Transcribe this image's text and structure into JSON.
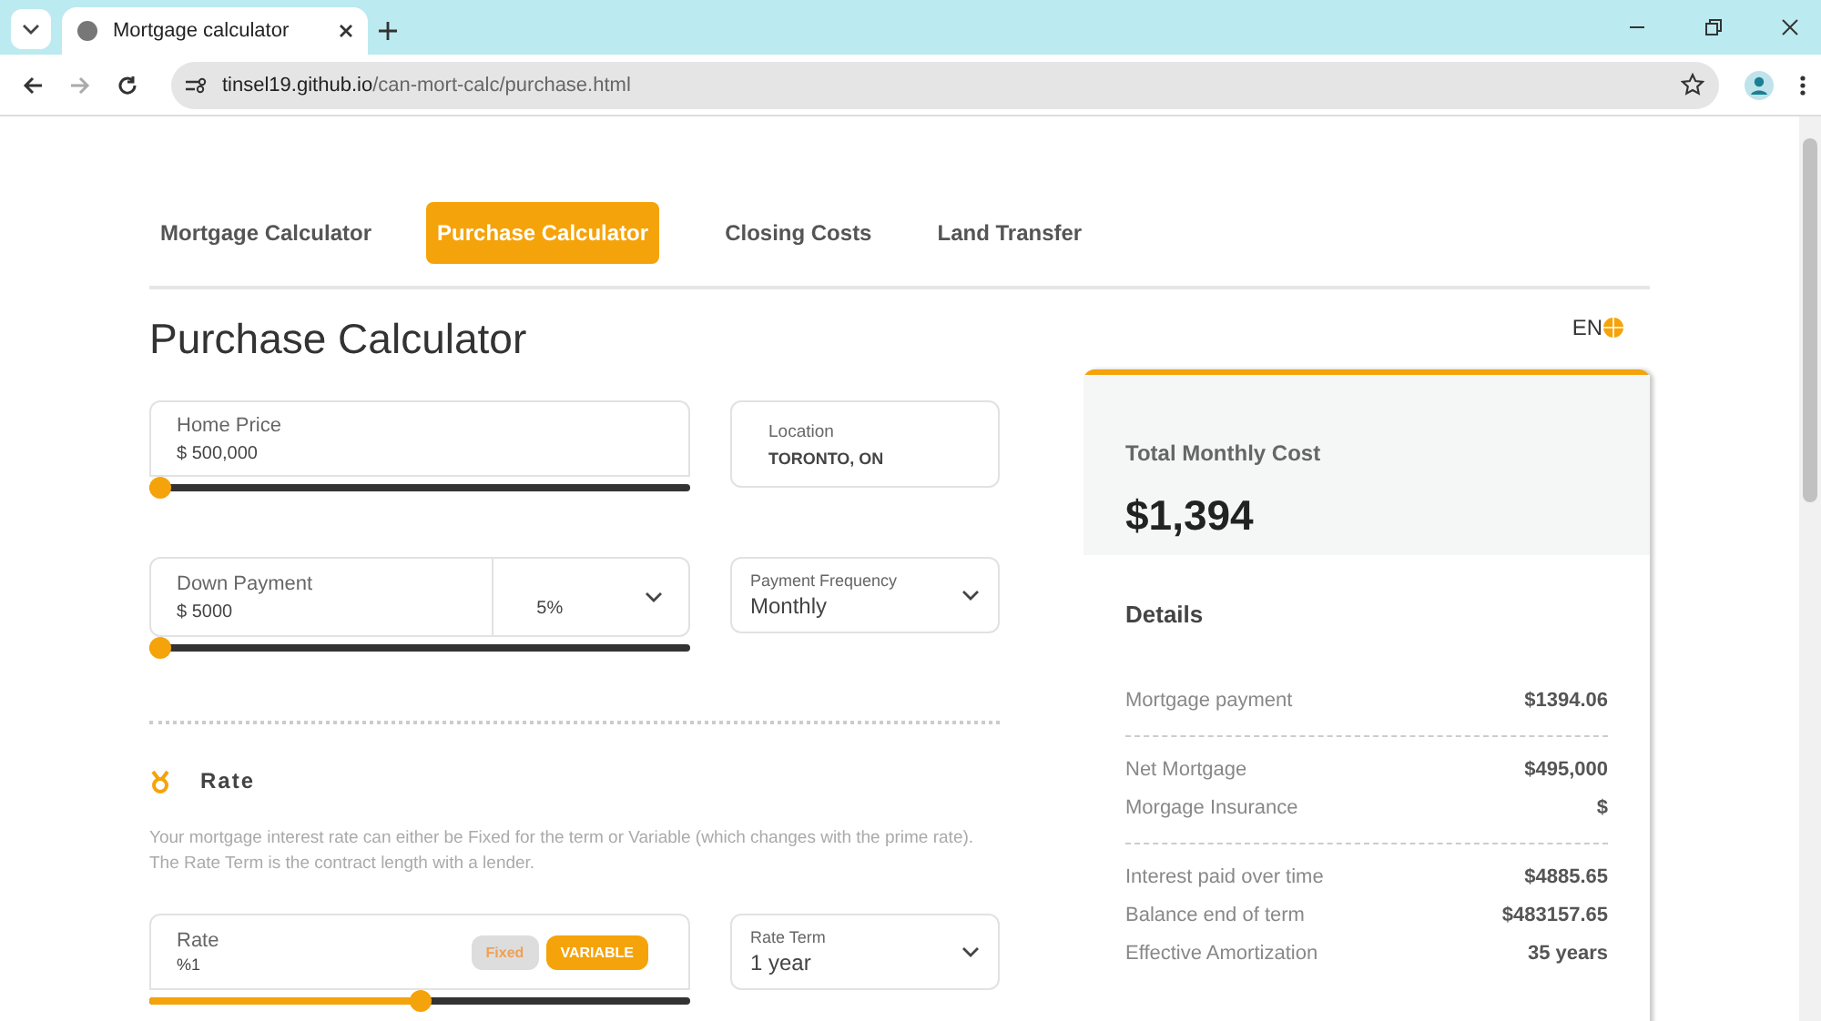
{
  "browser": {
    "tab_title": "Mortgage calculator",
    "url_host": "tinsel19.github.io",
    "url_path": "/can-mort-calc/purchase.html"
  },
  "nav_tabs": [
    {
      "label": "Mortgage Calculator",
      "selected": false
    },
    {
      "label": "Purchase Calculator",
      "selected": true
    },
    {
      "label": "Closing Costs",
      "selected": false
    },
    {
      "label": "Land Transfer",
      "selected": false
    }
  ],
  "language": "EN",
  "title": "Purchase Calculator",
  "home_price": {
    "label": "Home Price",
    "value": "$ 500,000",
    "level": 0
  },
  "location": {
    "label": "Location",
    "value": "TORONTO, ON"
  },
  "down_payment": {
    "label": "Down Payment",
    "value": "$ 5000",
    "percent": "5%",
    "level": 0
  },
  "payment_frequency": {
    "label": "Payment Frequency",
    "value": "Monthly"
  },
  "rate_section": {
    "title": "Rate",
    "description": "Your mortgage interest rate can either be Fixed for the term or Variable (which changes with the prime rate). The Rate Term is the contract length with a lender.",
    "rate": {
      "label": "Rate",
      "value": "%1",
      "level": 0.5
    },
    "rate_types": [
      {
        "label": "Fixed",
        "selected": false
      },
      {
        "label": "VARIABLE",
        "selected": true
      }
    ],
    "rate_term": {
      "label": "Rate Term",
      "value": "1 year"
    }
  },
  "summary": {
    "title": "Total Monthly Cost",
    "amount": "$1,394",
    "details_title": "Details",
    "groups": [
      [
        {
          "label": "Mortgage payment",
          "value": "$1394.06"
        }
      ],
      [
        {
          "label": "Net Mortgage",
          "value": "$495,000"
        },
        {
          "label": "Morgage Insurance",
          "value": "$"
        }
      ],
      [
        {
          "label": "Interest paid over time",
          "value": "$4885.65"
        },
        {
          "label": "Balance end of term",
          "value": "$483157.65"
        },
        {
          "label": "Effective Amortization",
          "value": "35 years"
        }
      ]
    ]
  }
}
